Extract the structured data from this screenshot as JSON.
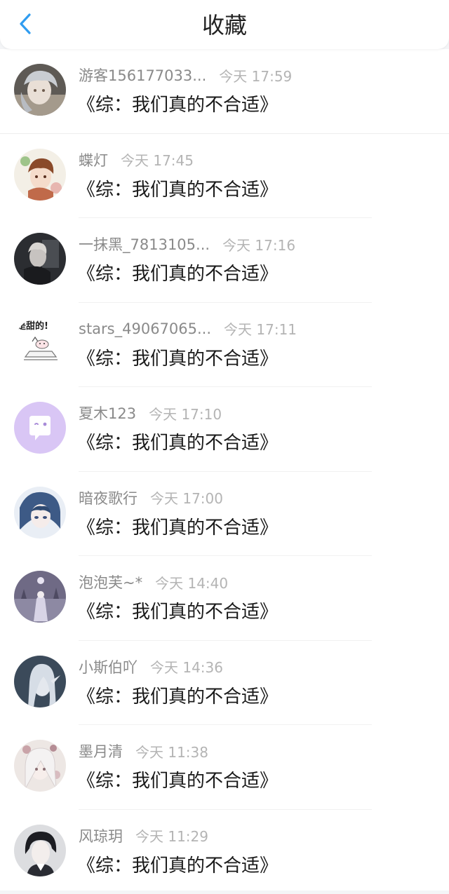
{
  "header": {
    "title": "收藏",
    "back_icon": "chevron-left-icon",
    "accent_color": "#2f9cf0"
  },
  "favorites": [
    {
      "username": "游客156177033...",
      "time": "今天 17:59",
      "book_title": "《综：我们真的不合适》",
      "avatar": "anime-avatar-silver-hair"
    },
    {
      "username": "蝶灯",
      "time": "今天 17:45",
      "book_title": "《综：我们真的不合适》",
      "avatar": "anime-avatar-brown-hair-flowers"
    },
    {
      "username": "一抹黑_7813105...",
      "time": "今天 17:16",
      "book_title": "《综：我们真的不合适》",
      "avatar": "anime-avatar-dark"
    },
    {
      "username": "stars_49067065...",
      "time": "今天 17:11",
      "book_title": "《综：我们真的不合适》",
      "avatar": "doodle-avatar",
      "avatar_text": "是甜的!"
    },
    {
      "username": "夏木123",
      "time": "今天 17:10",
      "book_title": "《综：我们真的不合适》",
      "avatar": "default-chat-avatar",
      "avatar_color": "#d9c6f5"
    },
    {
      "username": "暗夜歌行",
      "time": "今天 17:00",
      "book_title": "《综：我们真的不合适》",
      "avatar": "anime-avatar-blue-hair"
    },
    {
      "username": "泡泡芙~*",
      "time": "今天 14:40",
      "book_title": "《综：我们真的不合适》",
      "avatar": "anime-avatar-castle"
    },
    {
      "username": "小斯伯吖",
      "time": "今天 14:36",
      "book_title": "《综：我们真的不合适》",
      "avatar": "anime-avatar-elf"
    },
    {
      "username": "墨月清",
      "time": "今天 11:38",
      "book_title": "《综：我们真的不合适》",
      "avatar": "anime-avatar-white-hair-flowers"
    },
    {
      "username": "风琼玥",
      "time": "今天 11:29",
      "book_title": "《综：我们真的不合适》",
      "avatar": "anime-avatar-black-hair"
    }
  ]
}
